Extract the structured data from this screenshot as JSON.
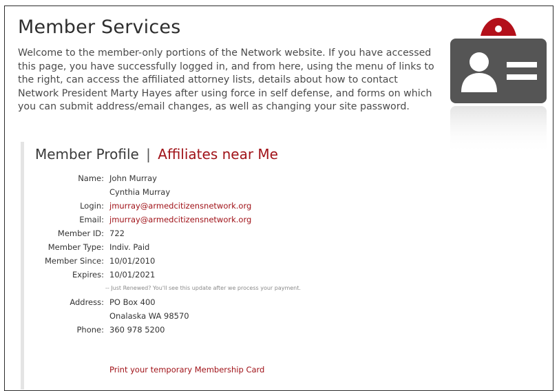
{
  "page": {
    "title": "Member Services",
    "intro": "Welcome to the member-only portions of the Network website. If you have accessed this page, you have successfully  logged in, and from here, using the menu of links to the right, can access the affiliated attorney lists, details about how to contact Network President Marty Hayes after using force in self defense, and forms on which you can submit address/email changes, as well as changing your site password."
  },
  "profile": {
    "heading": "Member Profile",
    "separator": "|",
    "affiliates_link": "Affiliates near Me",
    "name_label": "Name:",
    "name_1": "John Murray",
    "name_2": "Cynthia Murray",
    "login_label": "Login:",
    "login": "jmurray@armedcitizensnetwork.org",
    "email_label": "Email:",
    "email": "jmurray@armedcitizensnetwork.org",
    "member_id_label": "Member ID:",
    "member_id": "722",
    "member_type_label": "Member Type:",
    "member_type": "Indiv. Paid",
    "member_since_label": "Member Since:",
    "member_since": "10/01/2010",
    "expires_label": "Expires:",
    "expires": "10/01/2021",
    "renew_note": "-- Just Renewed? You'll see this update after we process your payment.",
    "address_label": "Address:",
    "address_1": "PO Box 400",
    "address_2": "Onalaska WA   98570",
    "phone_label": "Phone:",
    "phone": "360 978 5200",
    "print_link": "Print your temporary Membership Card"
  },
  "colors": {
    "accent_red": "#a01218",
    "card_gray": "#555555"
  },
  "icons": {
    "badge": "id-card-icon"
  }
}
